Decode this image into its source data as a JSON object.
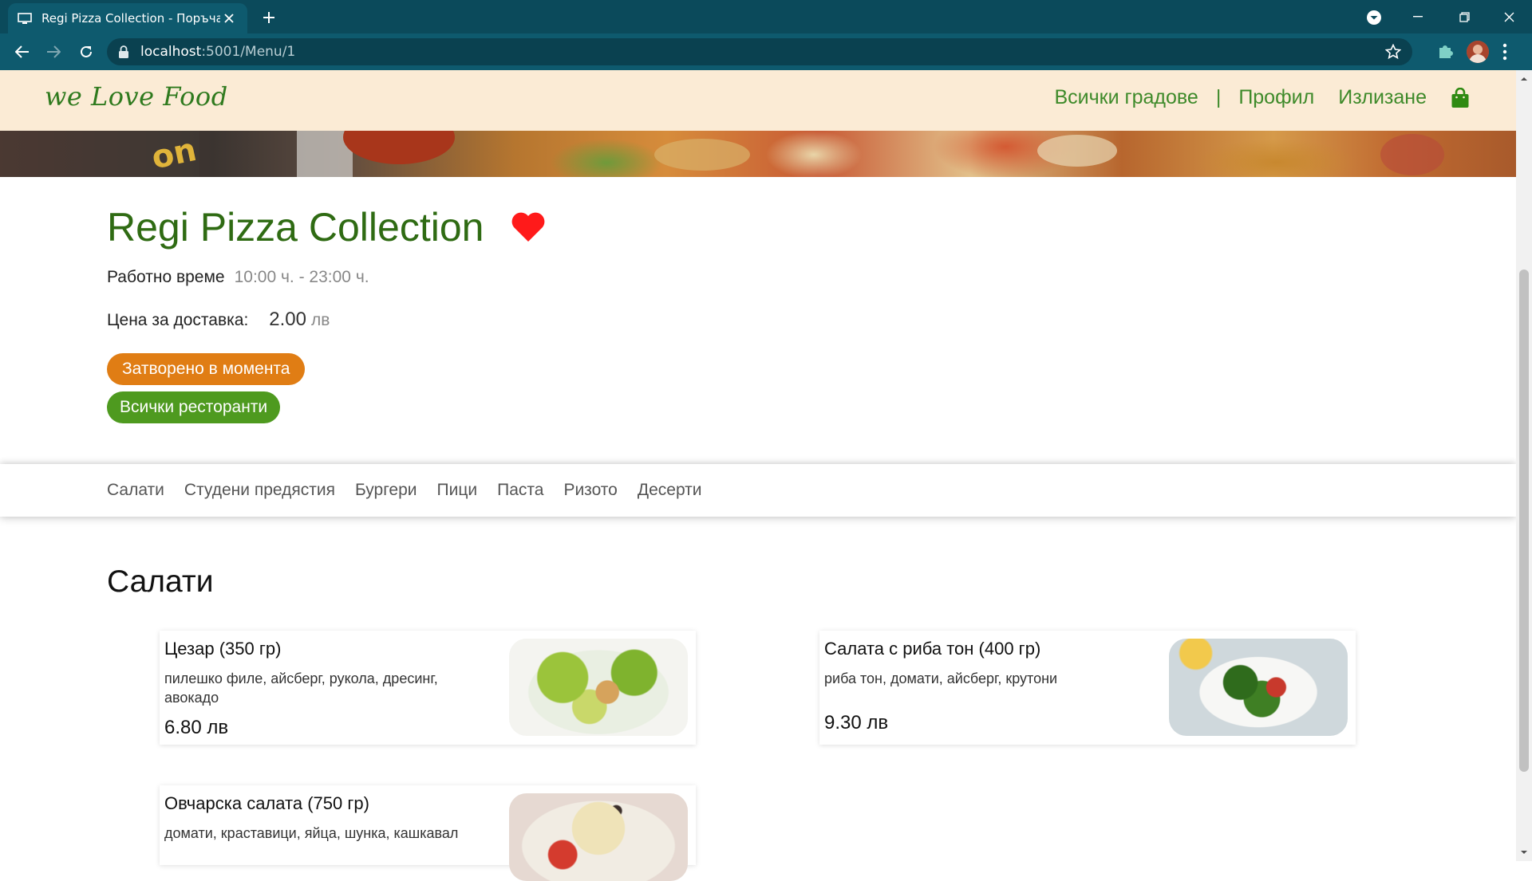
{
  "browser": {
    "tab_title": "Regi Pizza Collection - Поръчай",
    "url_host": "localhost",
    "url_path": ":5001/Menu/1"
  },
  "site": {
    "logo": "we Love Food",
    "nav": {
      "cities": "Всички градове",
      "separator": "|",
      "profile": "Профил",
      "logout": "Излизане"
    }
  },
  "restaurant": {
    "name": "Regi Pizza Collection",
    "hours_label": "Работно време",
    "hours_value": "10:00 ч. - 23:00 ч.",
    "fee_label": "Цена за доставка:",
    "fee_value": "2.00",
    "fee_currency": "лв",
    "status_button": "Затворено в момента",
    "all_restaurants_button": "Всички ресторанти"
  },
  "categories": [
    "Салати",
    "Студени предястия",
    "Бургери",
    "Пици",
    "Паста",
    "Ризото",
    "Десерти"
  ],
  "menu_section": {
    "title": "Салати",
    "items": [
      {
        "name": "Цезар (350 гр)",
        "description": "пилешко филе, айсберг, рукола, дресинг, авокадо",
        "price": "6.80 лв"
      },
      {
        "name": "Салата с риба тон (400 гр)",
        "description": "риба тон, домати, айсберг, крутони",
        "price": "9.30 лв"
      },
      {
        "name": "Овчарска салата (750 гр)",
        "description": "домати, краставици, яйца, шунка, кашкавал",
        "price": ""
      }
    ]
  },
  "colors": {
    "tab_bar": "#0b4a5b",
    "header_bg": "#fbebd5",
    "brand_green": "#2f6b13",
    "closed_orange": "#e07d14",
    "all_green": "#4e9a1f",
    "heart_red": "#ff1a1a"
  }
}
